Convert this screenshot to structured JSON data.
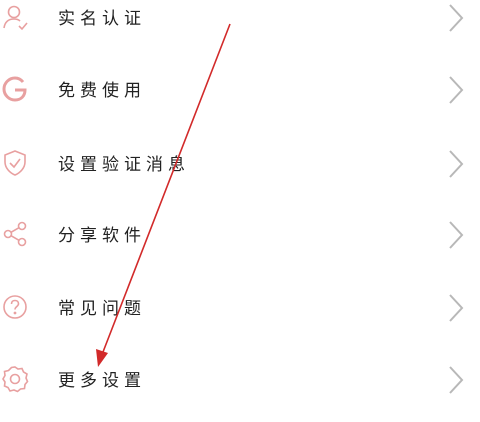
{
  "accent_color": "#e8a0a0",
  "arrow_color": "#d22a2a",
  "menu": {
    "items": [
      {
        "label": "实名认证",
        "icon": "user-check-icon"
      },
      {
        "label": "免费使用",
        "icon": "g-logo-icon"
      },
      {
        "label": "设置验证消息",
        "icon": "shield-check-icon"
      },
      {
        "label": "分享软件",
        "icon": "share-icon"
      },
      {
        "label": "常见问题",
        "icon": "question-circle-icon"
      },
      {
        "label": "更多设置",
        "icon": "gear-icon"
      }
    ]
  }
}
